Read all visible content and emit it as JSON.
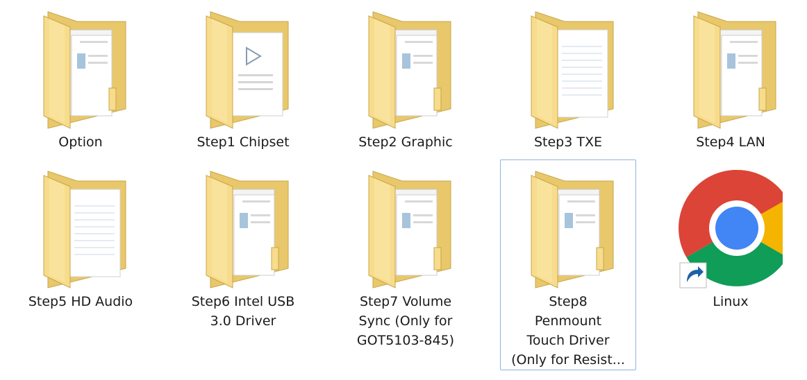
{
  "items": [
    {
      "label": "Option",
      "icon": "folder-icon",
      "variant": "files"
    },
    {
      "label": "Step1  Chipset",
      "icon": "folder-icon",
      "variant": "docs"
    },
    {
      "label": "Step2  Graphic",
      "icon": "folder-icon",
      "variant": "files"
    },
    {
      "label": "Step3  TXE",
      "icon": "folder-icon",
      "variant": "papers"
    },
    {
      "label": "Step4  LAN",
      "icon": "folder-icon",
      "variant": "files"
    },
    {
      "label": "Step5  HD Audio",
      "icon": "folder-icon",
      "variant": "papers"
    },
    {
      "label": "Step6  Intel USB\n3.0 Driver",
      "icon": "folder-icon",
      "variant": "files"
    },
    {
      "label": "Step7  Volume\nSync (Only for\nGOT5103-845)",
      "icon": "folder-icon",
      "variant": "files"
    },
    {
      "label": "Step8\nPenmount\nTouch Driver\n(Only for Resist...",
      "icon": "folder-icon",
      "variant": "files",
      "selected": true
    },
    {
      "label": "Linux",
      "icon": "chrome-shortcut-icon"
    }
  ],
  "colors": {
    "folder_back": "#e8c86a",
    "folder_front": "#f6dc8c",
    "selection_border": "#8fb4d9",
    "chrome_red": "#db4437",
    "chrome_green": "#0f9d58",
    "chrome_yellow": "#f4b400",
    "chrome_blue": "#4285f4"
  }
}
